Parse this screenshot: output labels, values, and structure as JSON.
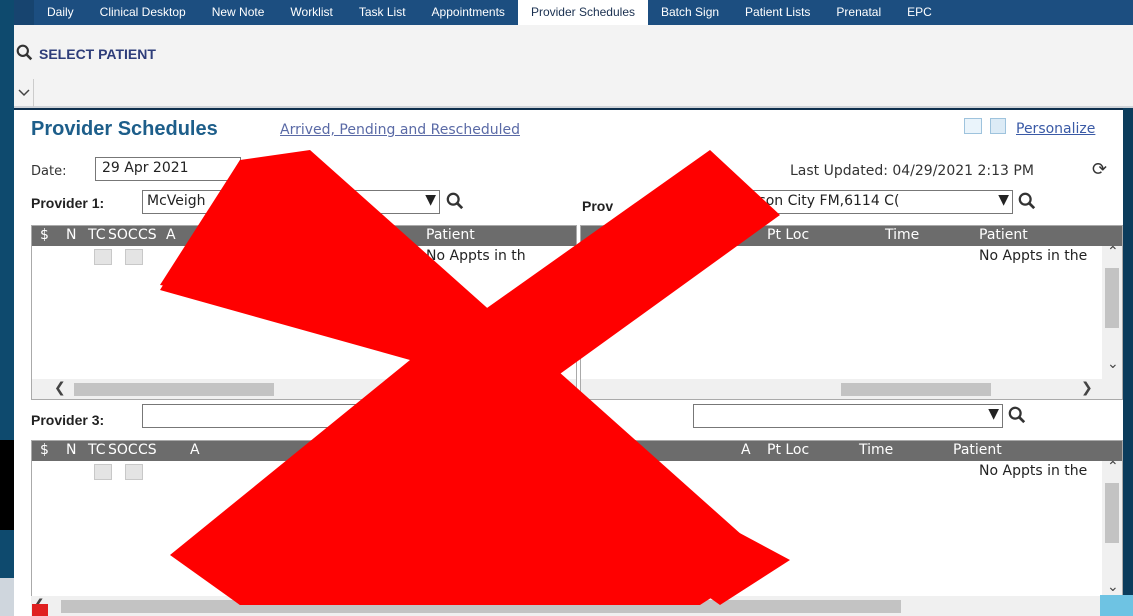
{
  "nav": {
    "tabs": [
      "Daily",
      "Clinical Desktop",
      "New Note",
      "Worklist",
      "Task List",
      "Appointments",
      "Provider Schedules",
      "Batch Sign",
      "Patient Lists",
      "Prenatal",
      "EPC"
    ],
    "active_tab": "Provider Schedules"
  },
  "patient_bar": {
    "label": "SELECT PATIENT"
  },
  "page": {
    "title": "Provider Schedules",
    "filter_link": "Arrived, Pending and Rescheduled",
    "personalize": "Personalize",
    "date_label": "Date:",
    "date_value": "29 Apr 2021",
    "last_updated": "Last Updated: 04/29/2021 2:13 PM"
  },
  "provider1": {
    "label": "Provider 1:",
    "value": "McVeigh",
    "columns": [
      "$",
      "N",
      "TC",
      "SOC",
      "CS",
      "A",
      "Patient"
    ],
    "empty_text": "No Appts in th"
  },
  "provider2": {
    "label": "Prov",
    "value": "Johnson City FM,6114 C(",
    "columns": [
      "Pt Loc",
      "Time",
      "Patient"
    ],
    "empty_text": "No Appts in the"
  },
  "provider3": {
    "label": "Provider 3:",
    "value": "",
    "columns": [
      "$",
      "N",
      "TC",
      "SOC",
      "CS",
      "A"
    ],
    "empty_text": "Appts"
  },
  "provider4": {
    "value": "",
    "columns": [
      "A",
      "Pt Loc",
      "Time",
      "Patient"
    ],
    "empty_text": "No Appts in the"
  },
  "colors": {
    "nav_bg": "#1c4e80",
    "title": "#1d5e8a",
    "overlay_x": "#ff0000"
  }
}
